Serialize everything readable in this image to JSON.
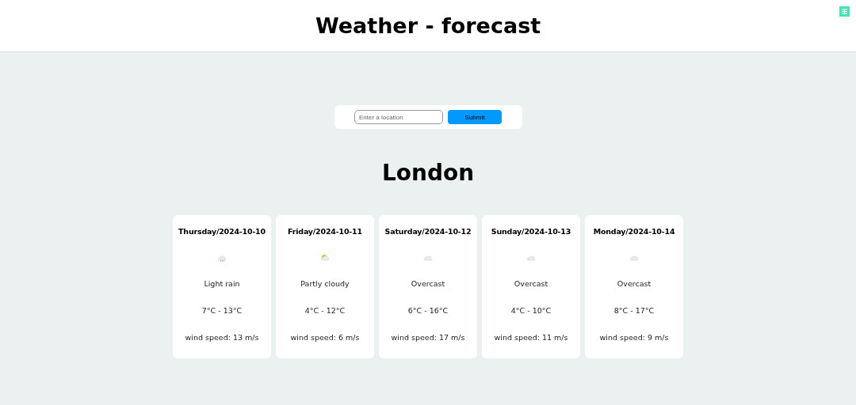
{
  "header": {
    "title": "Weather - forecast"
  },
  "search": {
    "placeholder": "Enter a location",
    "button": "Submit"
  },
  "city": "London",
  "days": [
    {
      "date": "Thursday/2024-10-10",
      "kind": "rain",
      "condition": "Light rain",
      "temperature": "7°C - 13°C",
      "wind": "wind speed: 13 m/s"
    },
    {
      "date": "Friday/2024-10-11",
      "kind": "partly-cloudy",
      "condition": "Partly cloudy",
      "temperature": "4°C - 12°C",
      "wind": "wind speed: 6 m/s"
    },
    {
      "date": "Saturday/2024-10-12",
      "kind": "overcast",
      "condition": "Overcast",
      "temperature": "6°C - 16°C",
      "wind": "wind speed: 17 m/s"
    },
    {
      "date": "Sunday/2024-10-13",
      "kind": "overcast",
      "condition": "Overcast",
      "temperature": "4°C - 10°C",
      "wind": "wind speed: 11 m/s"
    },
    {
      "date": "Monday/2024-10-14",
      "kind": "overcast",
      "condition": "Overcast",
      "temperature": "8°C - 17°C",
      "wind": "wind speed: 9 m/s"
    }
  ]
}
